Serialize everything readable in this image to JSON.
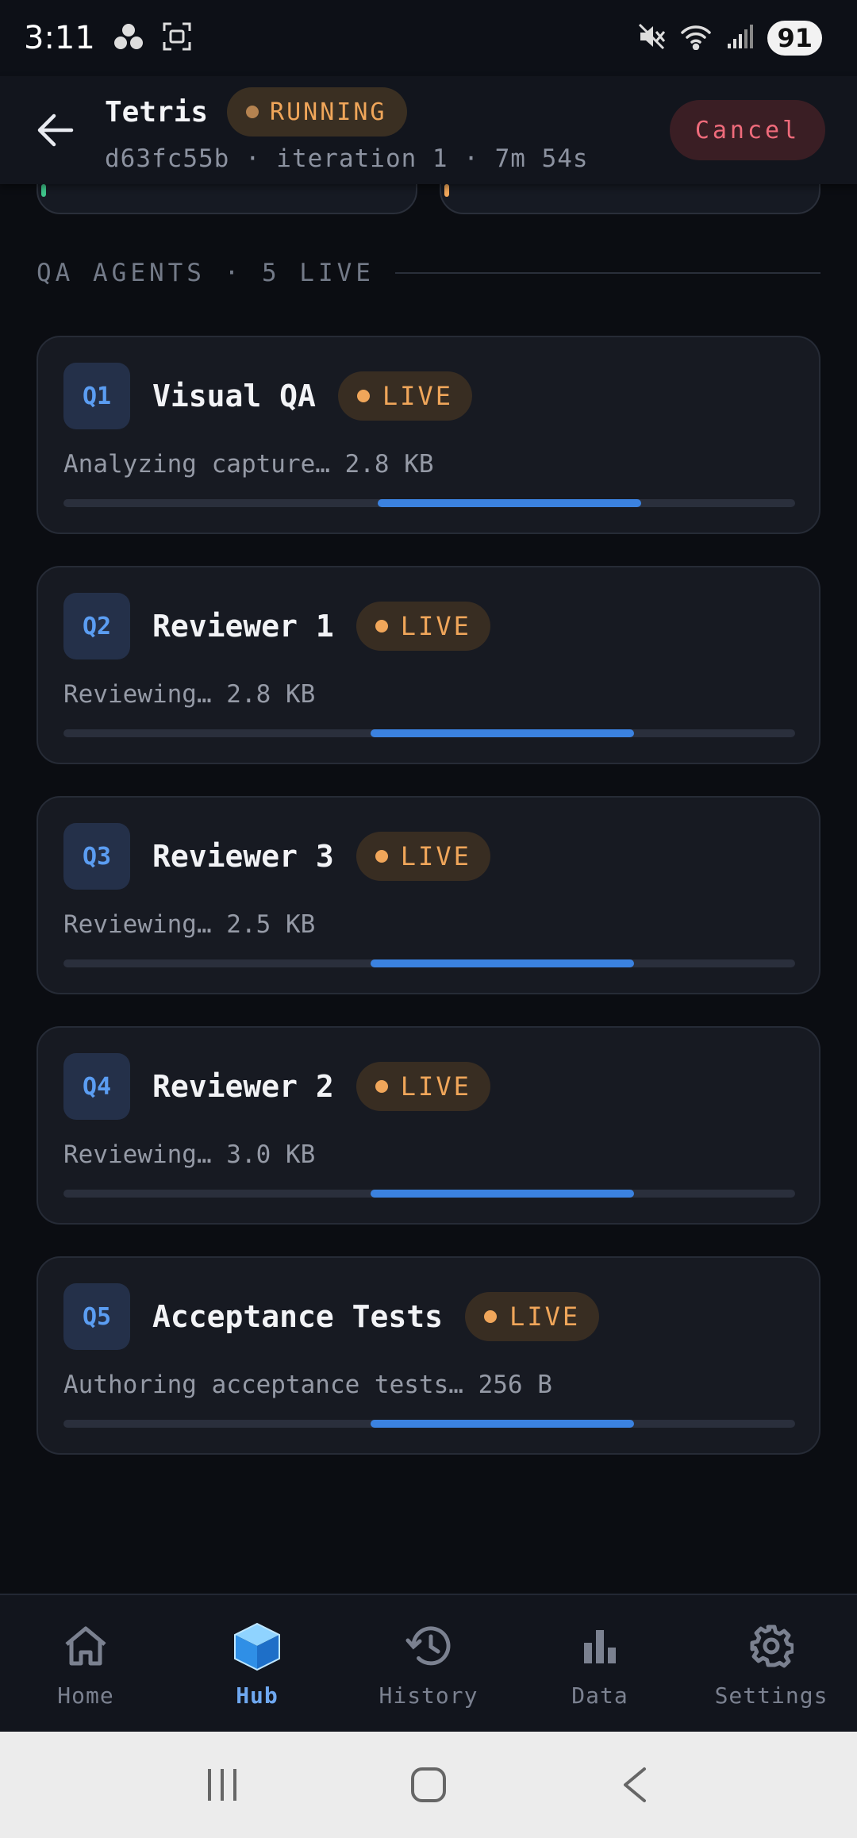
{
  "status_bar": {
    "time": "3:11",
    "battery": "91"
  },
  "header": {
    "title": "Tetris",
    "status_badge": "RUNNING",
    "subtitle": "d63fc55b · iteration 1 · 7m 54s",
    "cancel_label": "Cancel"
  },
  "section": {
    "title": "QA AGENTS · 5 LIVE"
  },
  "agents": [
    {
      "id": "Q1",
      "name": "Visual QA",
      "badge": "LIVE",
      "status": "Analyzing capture… 2.8 KB",
      "progress_start": 0.43,
      "progress_end": 0.79
    },
    {
      "id": "Q2",
      "name": "Reviewer 1",
      "badge": "LIVE",
      "status": "Reviewing… 2.8 KB",
      "progress_start": 0.42,
      "progress_end": 0.78
    },
    {
      "id": "Q3",
      "name": "Reviewer 3",
      "badge": "LIVE",
      "status": "Reviewing… 2.5 KB",
      "progress_start": 0.42,
      "progress_end": 0.78
    },
    {
      "id": "Q4",
      "name": "Reviewer 2",
      "badge": "LIVE",
      "status": "Reviewing… 3.0 KB",
      "progress_start": 0.42,
      "progress_end": 0.78
    },
    {
      "id": "Q5",
      "name": "Acceptance Tests",
      "badge": "LIVE",
      "status": "Authoring acceptance tests… 256 B",
      "progress_start": 0.42,
      "progress_end": 0.78
    }
  ],
  "bottom_nav": {
    "items": [
      {
        "label": "Home",
        "icon": "home-icon",
        "active": false
      },
      {
        "label": "Hub",
        "icon": "cube-icon",
        "active": true
      },
      {
        "label": "History",
        "icon": "history-icon",
        "active": false
      },
      {
        "label": "Data",
        "icon": "bar-chart-icon",
        "active": false
      },
      {
        "label": "Settings",
        "icon": "gear-icon",
        "active": false
      }
    ]
  },
  "colors": {
    "accent_blue": "#3b82e0",
    "live_orange": "#f0a65a",
    "cancel_red": "#ef6b7b"
  }
}
